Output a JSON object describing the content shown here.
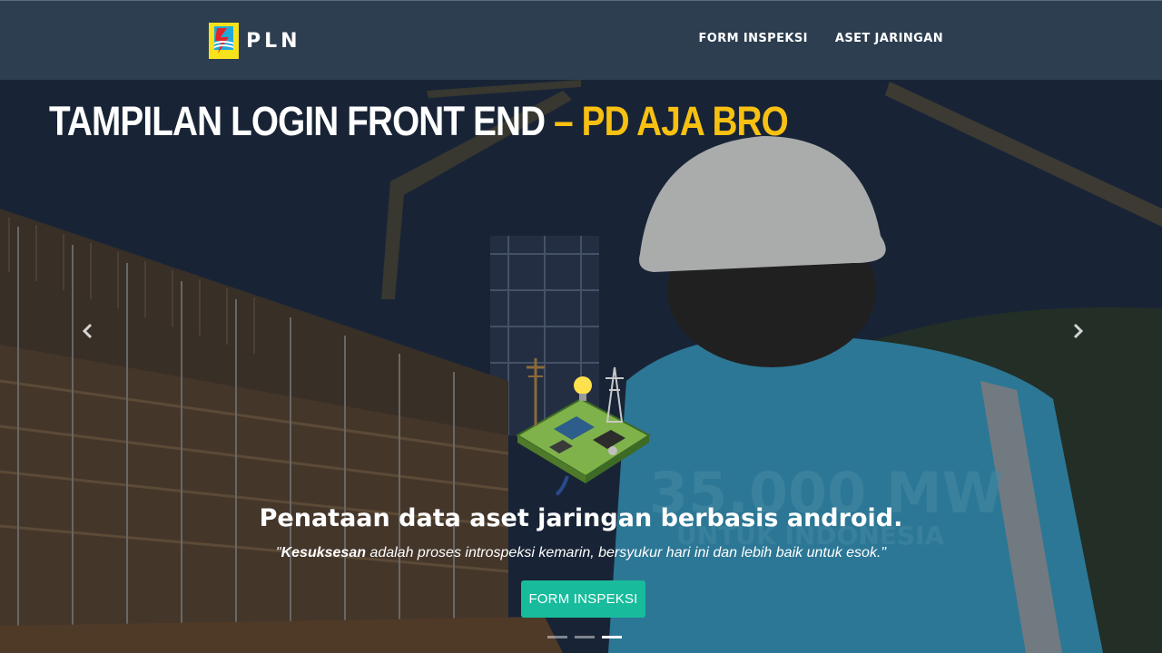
{
  "brand": {
    "name": "PLN",
    "logo_color": "#f7e21b"
  },
  "nav": {
    "items": [
      {
        "label": "FORM INSPEKSI"
      },
      {
        "label": "ASET JARINGAN"
      }
    ],
    "background": "#2c3e50"
  },
  "overlay": {
    "title_white": "TAMPILAN LOGIN FRONT END",
    "title_yellow": "– PD AJA BRO",
    "yellow_color": "#f8c112"
  },
  "hero": {
    "background_text": "35.000 MW",
    "background_subtext": "UNTUK INDONESIA",
    "slide_count": 3,
    "active_slide": 3
  },
  "carousel": {
    "prev_icon": "chevron-left-icon",
    "next_icon": "chevron-right-icon"
  },
  "caption": {
    "title": "Penataan data aset jaringan berbasis android.",
    "quote_open": "\"",
    "quote_bold": "Kesuksesan",
    "quote_rest": " adalah proses introspeksi kemarin, bersyukur hari ini dan lebih baik untuk esok.\"",
    "button_label": "FORM INSPEKSI",
    "button_color": "#18bc9c"
  }
}
